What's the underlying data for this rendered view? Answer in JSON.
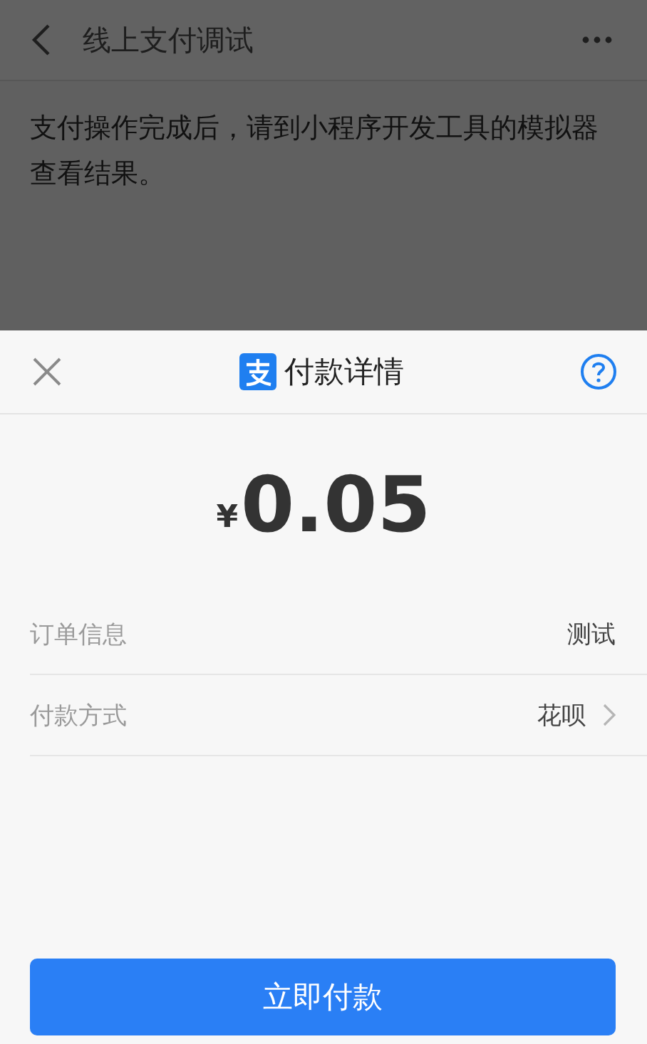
{
  "nav_bar": {
    "title": "线上支付调试"
  },
  "message": "支付操作完成后，请到小程序开发工具的模拟器查看结果。",
  "payment_sheet": {
    "title": "付款详情",
    "amount": {
      "currency": "¥",
      "value": "0.05"
    },
    "rows": [
      {
        "kind": "plain",
        "label": "订单信息",
        "value": "测试"
      },
      {
        "kind": "link",
        "label": "付款方式",
        "value": "花呗"
      }
    ],
    "button": "立即付款"
  }
}
